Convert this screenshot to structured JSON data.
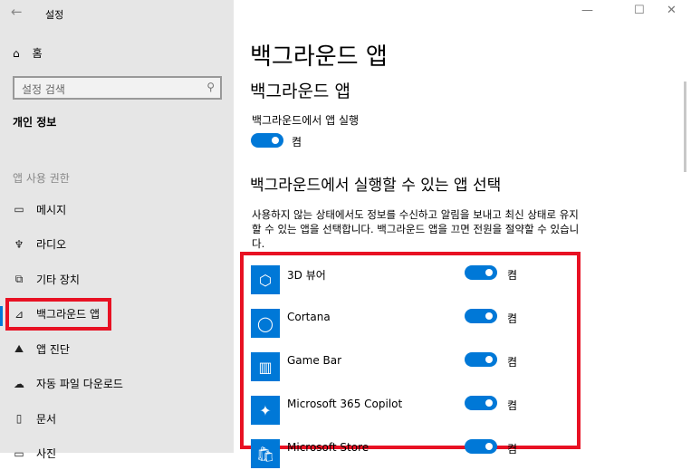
{
  "window": {
    "title": "설정",
    "minimize": "—",
    "maximize": "☐",
    "close": "✕"
  },
  "sidebar": {
    "home": "홈",
    "search_placeholder": "설정 검색",
    "section": "개인 정보",
    "permissions_header": "앱 사용 권한",
    "items": [
      {
        "label": "메시지",
        "icon": "message-icon",
        "glyph": "▭"
      },
      {
        "label": "라디오",
        "icon": "radio-tower-icon",
        "glyph": "♆"
      },
      {
        "label": "기타 장치",
        "icon": "devices-icon",
        "glyph": "⧉"
      },
      {
        "label": "백그라운드 앱",
        "icon": "background-apps-icon",
        "glyph": "⊿",
        "selected": true
      },
      {
        "label": "앱 진단",
        "icon": "diagnostics-icon",
        "glyph": "⛰"
      },
      {
        "label": "자동 파일 다운로드",
        "icon": "cloud-icon",
        "glyph": "☁"
      },
      {
        "label": "문서",
        "icon": "document-icon",
        "glyph": "▯"
      },
      {
        "label": "사진",
        "icon": "pictures-icon",
        "glyph": "▭"
      }
    ]
  },
  "main": {
    "title": "백그라운드 앱",
    "subtitle": "백그라운드 앱",
    "run_label": "백그라운드에서 앱 실행",
    "run_state": "켬",
    "select_heading": "백그라운드에서 실행할 수 있는 앱 선택",
    "description": "사용하지 않는 상태에서도 정보를 수신하고 알림을 보내고 최신 상태로 유지할 수 있는 앱을 선택합니다. 백그라운드 앱을 끄면 전원을 절약할 수 있습니다.",
    "apps": [
      {
        "name": "3D 뷰어",
        "state": "켬",
        "icon": "3d-viewer-icon",
        "glyph": "⬡"
      },
      {
        "name": "Cortana",
        "state": "켬",
        "icon": "cortana-icon",
        "glyph": "◯"
      },
      {
        "name": "Game Bar",
        "state": "켬",
        "icon": "game-bar-icon",
        "glyph": "▥"
      },
      {
        "name": "Microsoft 365 Copilot",
        "state": "켬",
        "icon": "copilot-icon",
        "glyph": "✦"
      },
      {
        "name": "Microsoft Store",
        "state": "켬",
        "icon": "store-icon",
        "glyph": "🛍"
      }
    ]
  },
  "colors": {
    "accent": "#0078d7",
    "highlight": "#e81123"
  }
}
